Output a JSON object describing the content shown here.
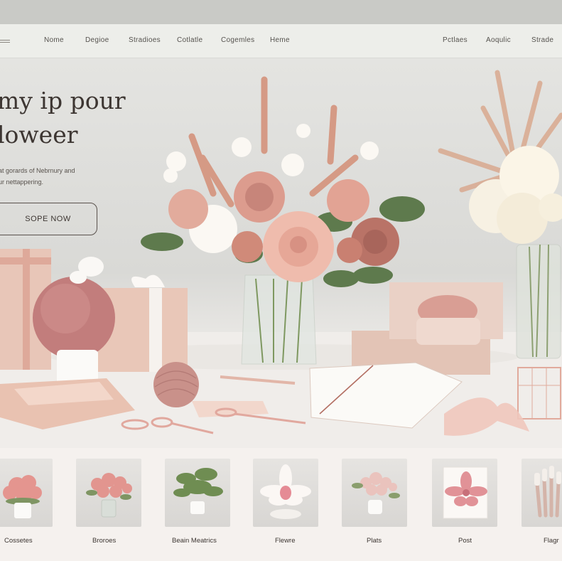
{
  "nav": {
    "left": [
      "Nome",
      "Degioe",
      "Stradioes",
      "Cotlatle",
      "Cogemles",
      "Heme"
    ],
    "right": [
      "Pctlaes",
      "Aoqulic",
      "Strade"
    ]
  },
  "hero": {
    "title_line1": "my ip pour",
    "title_line2": "loweer",
    "subtitle_line1": "at gorards of Nebrnury and",
    "subtitle_line2": "ur nettappering.",
    "cta_label": "SOPE NOW"
  },
  "categories": [
    {
      "label": "Cossetes",
      "icon": "pink-carnation-pot-icon"
    },
    {
      "label": "Broroes",
      "icon": "pink-bouquet-vase-icon"
    },
    {
      "label": "Beain Meatrics",
      "icon": "green-fern-pot-icon"
    },
    {
      "label": "Flewre",
      "icon": "white-lily-bowl-icon"
    },
    {
      "label": "Plats",
      "icon": "blush-flower-vase-icon"
    },
    {
      "label": "Post",
      "icon": "pink-orchid-card-icon"
    },
    {
      "label": "Flagr",
      "icon": "brush-set-icon"
    }
  ],
  "colors": {
    "accent": "#e8c1b2",
    "rose": "#dea093",
    "text": "#3d3632",
    "background": "#e9e7e3"
  }
}
